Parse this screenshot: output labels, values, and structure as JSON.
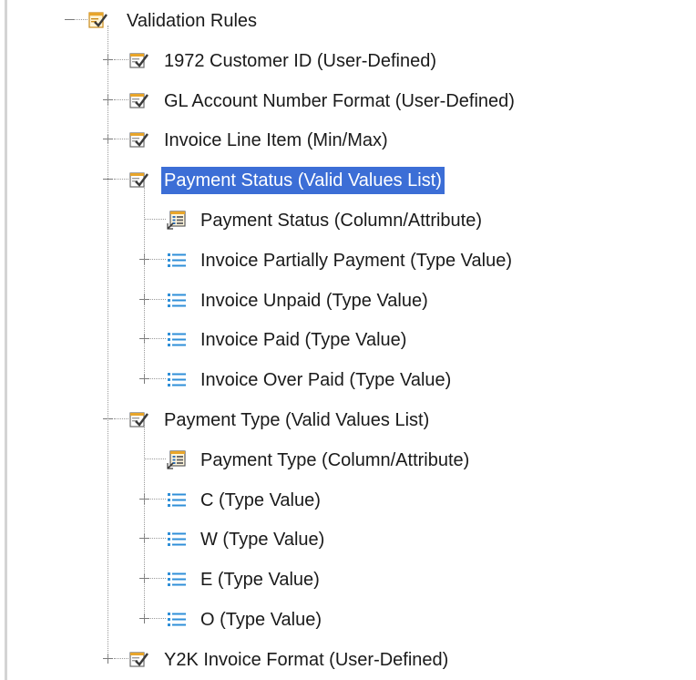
{
  "tree": {
    "root": {
      "label": "Validation Rules",
      "icon": "validation-rules-icon",
      "expanded": true
    },
    "rules": [
      {
        "label": "1972 Customer ID (User-Defined)",
        "icon": "rule-check-icon",
        "expanded": false
      },
      {
        "label": "GL Account Number Format (User-Defined)",
        "icon": "rule-check-icon",
        "expanded": false
      },
      {
        "label": "Invoice Line Item (Min/Max)",
        "icon": "rule-check-icon",
        "expanded": false
      },
      {
        "label": "Payment Status (Valid Values List)",
        "icon": "rule-check-icon",
        "expanded": true,
        "selected": true,
        "children": [
          {
            "label": "Payment Status (Column/Attribute)",
            "icon": "column-attribute-icon",
            "expandable": false
          },
          {
            "label": "Invoice Partially Payment (Type Value)",
            "icon": "list-icon",
            "expandable": true
          },
          {
            "label": "Invoice Unpaid (Type Value)",
            "icon": "list-icon",
            "expandable": true
          },
          {
            "label": "Invoice Paid (Type Value)",
            "icon": "list-icon",
            "expandable": true
          },
          {
            "label": "Invoice Over Paid (Type Value)",
            "icon": "list-icon",
            "expandable": true
          }
        ]
      },
      {
        "label": "Payment Type (Valid Values List)",
        "icon": "rule-check-icon",
        "expanded": true,
        "children": [
          {
            "label": "Payment Type (Column/Attribute)",
            "icon": "column-attribute-icon",
            "expandable": false
          },
          {
            "label": "C (Type Value)",
            "icon": "list-icon",
            "expandable": true
          },
          {
            "label": "W (Type Value)",
            "icon": "list-icon",
            "expandable": true
          },
          {
            "label": "E (Type Value)",
            "icon": "list-icon",
            "expandable": true
          },
          {
            "label": "O (Type Value)",
            "icon": "list-icon",
            "expandable": true
          }
        ]
      },
      {
        "label": "Y2K Invoice Format (User-Defined)",
        "icon": "rule-check-icon",
        "expanded": false
      }
    ]
  },
  "colors": {
    "selection_bg": "#3c6ed6",
    "selection_text": "#ffffff",
    "tree_line": "#9a9a9a",
    "list_icon": "#2f8fd8",
    "rule_icon_gold": "#e8a52a"
  }
}
